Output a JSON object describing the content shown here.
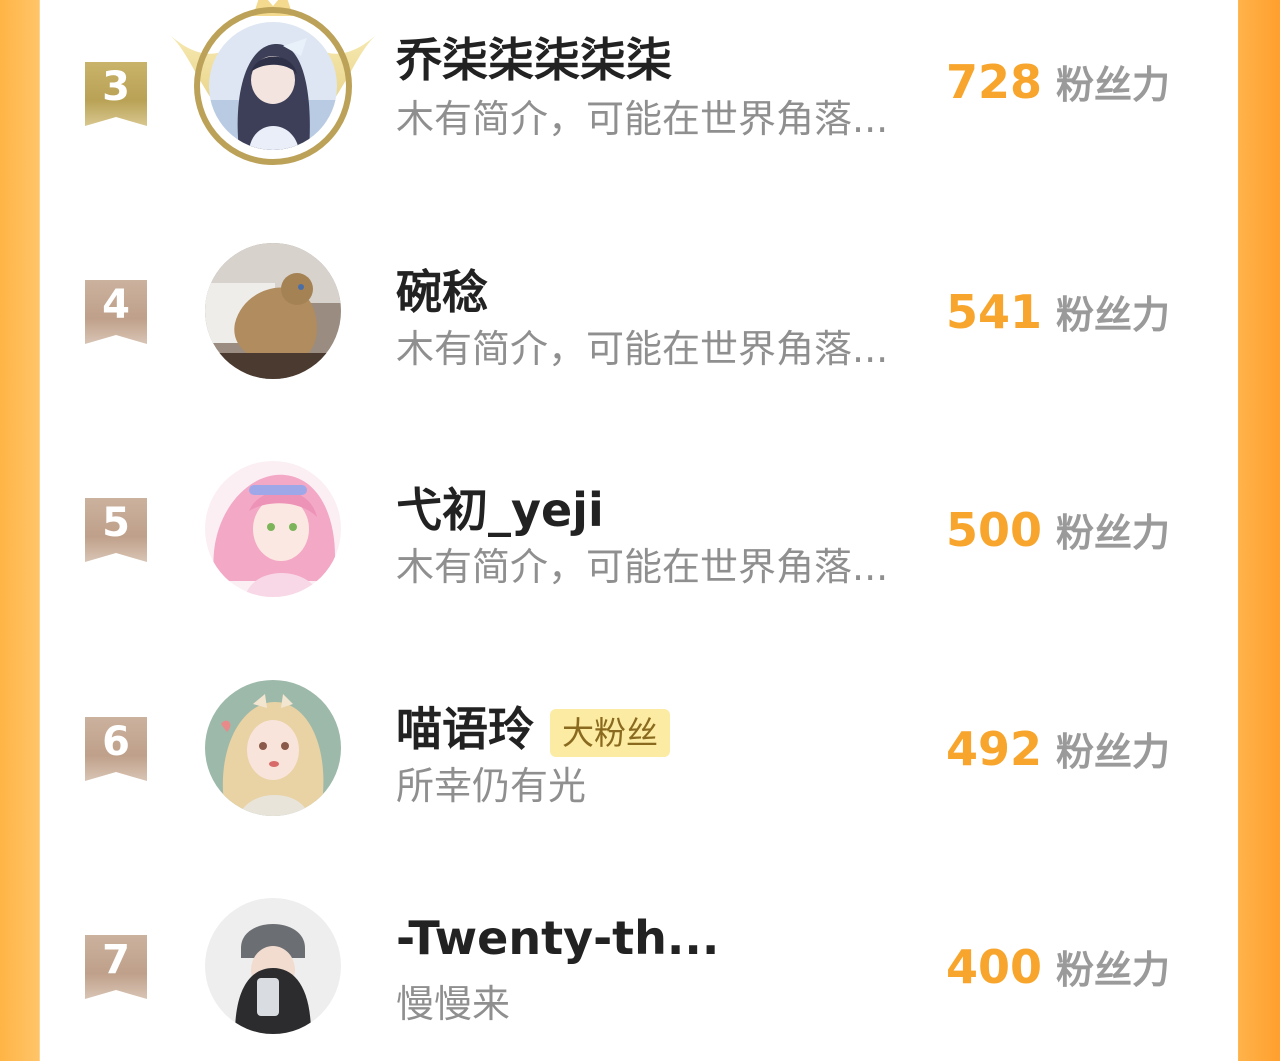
{
  "colors": {
    "accent_orange": "#F7A52C",
    "side_gradient": "#FFB445",
    "gold_badge": "#C2AA5F",
    "plain_badge": "#C6AA94",
    "fan_badge_bg": "#FCEBA3"
  },
  "ranking": {
    "unit_label": "粉丝力",
    "entries": [
      {
        "rank": "3",
        "name": "乔柒柒柒柒柒",
        "bio": "木有简介，可能在世界角落...",
        "score": "728",
        "crown": true,
        "avatar_icon": "anime-girl-avatar"
      },
      {
        "rank": "4",
        "name": "碗稔",
        "bio": "木有简介，可能在世界角落...",
        "score": "541",
        "crown": false,
        "avatar_icon": "cat-avatar"
      },
      {
        "rank": "5",
        "name": "弋初_yeji",
        "bio": "木有简介，可能在世界角落...",
        "score": "500",
        "crown": false,
        "avatar_icon": "pink-hair-girl-avatar"
      },
      {
        "rank": "6",
        "name": "喵语玲",
        "badge": "大粉丝",
        "bio": "所幸仍有光",
        "score": "492",
        "crown": false,
        "avatar_icon": "doll-girl-avatar"
      },
      {
        "rank": "7",
        "name": "-Twenty-th...",
        "bio": "慢慢来",
        "score": "400",
        "crown": false,
        "avatar_icon": "selfie-avatar"
      }
    ]
  }
}
